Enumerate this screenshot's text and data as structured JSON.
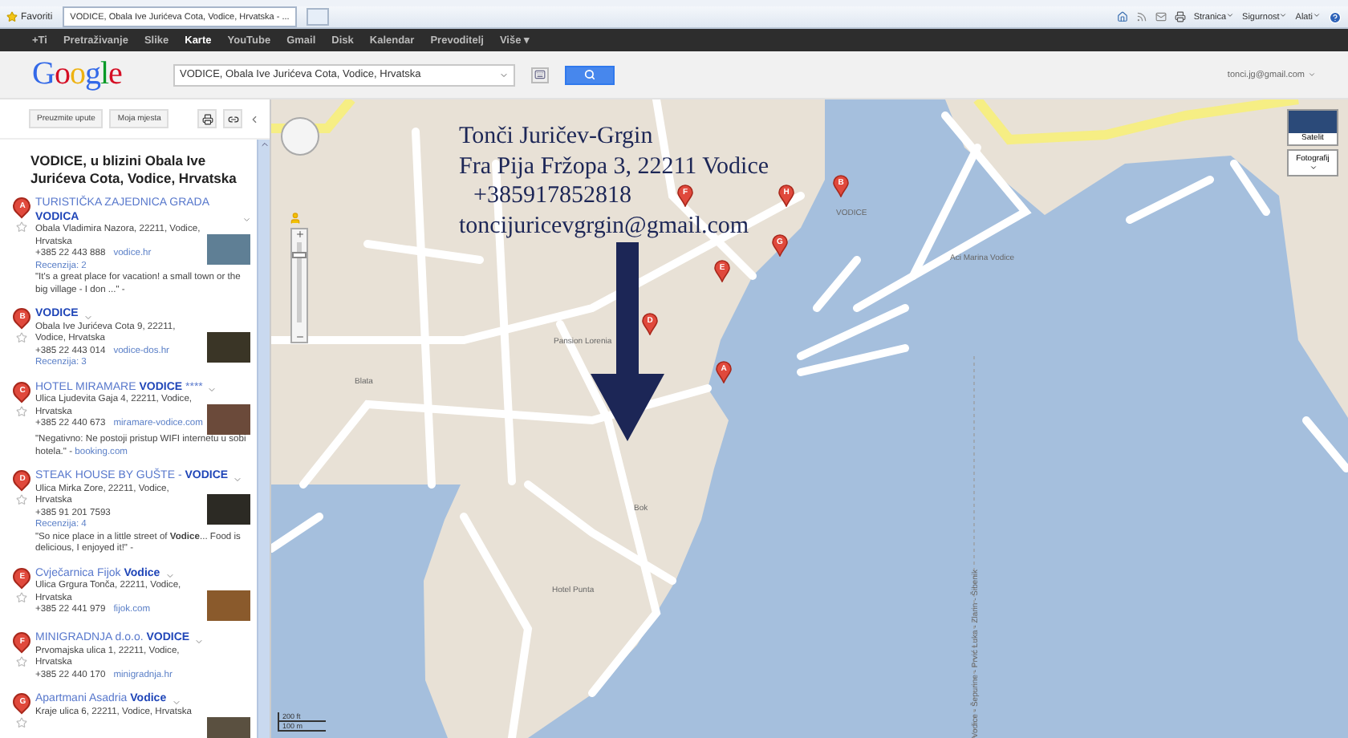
{
  "browser": {
    "favorites": "Favoriti",
    "tab_title": "VODICE, Obala Ive Jurićeva Cota, Vodice, Hrvatska - ...",
    "menus": [
      "Stranica",
      "Sigurnost",
      "Alati"
    ]
  },
  "google_bar": {
    "items": [
      {
        "label": "+Ti",
        "selected": false
      },
      {
        "label": "Pretraživanje",
        "selected": false
      },
      {
        "label": "Slike",
        "selected": false
      },
      {
        "label": "Karte",
        "selected": true
      },
      {
        "label": "YouTube",
        "selected": false
      },
      {
        "label": "Gmail",
        "selected": false
      },
      {
        "label": "Disk",
        "selected": false
      },
      {
        "label": "Kalendar",
        "selected": false
      },
      {
        "label": "Prevoditelj",
        "selected": false
      },
      {
        "label": "Više ▾",
        "selected": false
      }
    ]
  },
  "header": {
    "logo": "Google",
    "search_value": "VODICE, Obala Ive Jurićeva Cota, Vodice, Hrvatska",
    "user": "tonci.jg@gmail.com"
  },
  "sidebar": {
    "buttons": [
      "Preuzmite upute",
      "Moja mjesta"
    ],
    "heading": "**VODICE**, u blizini **Obala Ive Jurićeva Cota, Vodice, Hrvatska**",
    "results": [
      {
        "letter": "A",
        "title": "TURISTIČKA ZAJEDNICA GRADA **VODICA**",
        "address": "Obala Vladimira Nazora, 22211, Vodice, Hrvatska",
        "phone": "+385 22 443 888",
        "link": "vodice.hr",
        "review": "Recenzija: 2",
        "snippet": "\"It's a great place for vacation! a small town or the big village - I don ...\" -"
      },
      {
        "letter": "B",
        "title": "**VODICE**",
        "address": "Obala Ive Jurićeva Cota 9, 22211, Vodice, Hrvatska",
        "phone": "+385 22 443 014",
        "link": "vodice-dos.hr",
        "review": "Recenzija: 3"
      },
      {
        "letter": "C",
        "title": "HOTEL MIRAMARE **VODICE** ****",
        "address": "Ulica Ljudevita Gaja 4, 22211, Vodice, Hrvatska",
        "phone": "+385 22 440 673",
        "link": "miramare-vodice.com",
        "snippet": "\"Negativno: Ne postoji pristup WIFI internetu u sobi hotela.\" -",
        "snippet_source": "booking.com"
      },
      {
        "letter": "D",
        "title": "STEAK HOUSE BY GUŠTE - **VODICE**",
        "address": "Ulica Mirka Zore, 22211, Vodice, Hrvatska",
        "phone": "+385 91 201 7593",
        "review": "Recenzija: 4",
        "snippet": "\"So nice place in a little street of **Vodice**... Food is delicious, I enjoyed it!\" -"
      },
      {
        "letter": "E",
        "title": "Cvječarnica Fijok **Vodice**",
        "address": "Ulica Grgura Tonča, 22211, Vodice, Hrvatska",
        "phone": "+385 22 441 979",
        "link": "fijok.com"
      },
      {
        "letter": "F",
        "title": "MINIGRADNJA d.o.o. **VODICE**",
        "address": "Prvomajska ulica 1, 22211, Vodice, Hrvatska",
        "phone": "+385 22 440 170",
        "link": "minigradnja.hr"
      },
      {
        "letter": "G",
        "title": "Apartmani Asadria **Vodice**",
        "address": "Kraje ulica 6, 22211, Vodice, Hrvatska"
      }
    ]
  },
  "map": {
    "overlay_lines": [
      "Tonči Juričev-Grgin",
      "Fra Pija Fržopa 3, 22211 Vodice",
      "+385917852818",
      "toncijuricevgrgin@gmail.com"
    ],
    "pins": [
      "F",
      "H",
      "G",
      "E",
      "D",
      "A",
      "B"
    ],
    "labels": [
      "Blata",
      "Pansion Lorenia",
      "Aci Marina Vodice",
      "VODICE",
      "Bok",
      "Hotel Punta",
      "Vodice - Šepurine - Prvić Luka - Zlarin - Šibenik"
    ],
    "zoom": {
      "level": 0.88
    },
    "satellite": "Satelit",
    "photos": "Fotografij",
    "scale": [
      "200 ft",
      "100 m"
    ]
  }
}
